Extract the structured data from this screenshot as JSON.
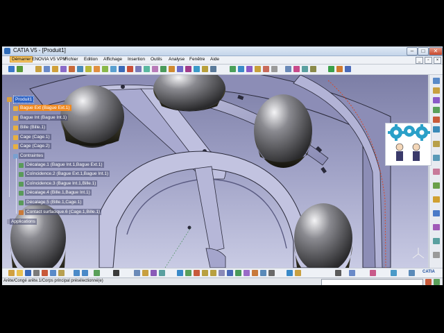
{
  "window": {
    "title": "CATIA V5 - [Produit1]"
  },
  "menu": [
    {
      "label": "Démarrer"
    },
    {
      "label": "ENOVIA V5 VPM"
    },
    {
      "label": "Fichier"
    },
    {
      "label": "Edition"
    },
    {
      "label": "Affichage"
    },
    {
      "label": "Insertion"
    },
    {
      "label": "Outils"
    },
    {
      "label": "Analyse"
    },
    {
      "label": "Fenêtre"
    },
    {
      "label": "Aide"
    }
  ],
  "tree": {
    "root": "Produit1",
    "items": [
      {
        "label": "Bague Ext (Bague Ext.1)",
        "selected": true
      },
      {
        "label": "Bague Int (Bague Int.1)"
      },
      {
        "label": "Bille (Bille.1)"
      },
      {
        "label": "Cage (Cage.1)"
      },
      {
        "label": "Cage (Cage.2)"
      }
    ],
    "constraints_label": "Contraintes",
    "constraints": [
      {
        "label": "Décalage.1 (Bague Int.1,Bague Ext.1)"
      },
      {
        "label": "Coïncidence.2 (Bague Ext.1,Bague Int.1)"
      },
      {
        "label": "Coïncidence.3 (Bague Int.1,Bille.1)"
      },
      {
        "label": "Décalage.4 (Bille.1,Bague Int.1)"
      },
      {
        "label": "Décalage.5 (Bille.1,Cage.1)"
      },
      {
        "label": "Contact surfacique.6 (Cage.1,Bille.1)"
      }
    ],
    "applications_label": "Applications"
  },
  "status": {
    "text": "Arête/Congé arête.1/Corps principal présélectionné(e)"
  },
  "brand": {
    "catia": "CATIA"
  },
  "icons": [
    "catia-logo-icon",
    "minimize-icon",
    "maximize-icon",
    "close-icon",
    "gear-icon",
    "compass-icon"
  ],
  "colors": {
    "accent": "#2d62c4",
    "selection": "#ef8a22",
    "viewport_top": "#7c7ea6",
    "viewport_bottom": "#c9cbe4"
  }
}
